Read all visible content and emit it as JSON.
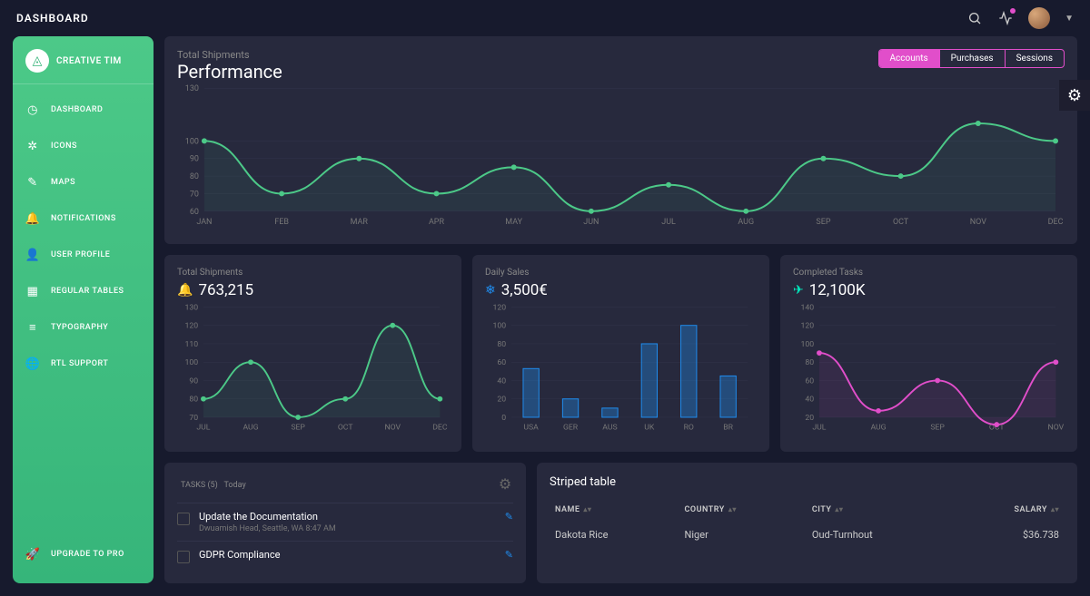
{
  "topbar": {
    "title": "DASHBOARD"
  },
  "sidebar": {
    "brand": "CREATIVE TIM",
    "items": [
      {
        "label": "DASHBOARD",
        "icon": "◷"
      },
      {
        "label": "ICONS",
        "icon": "✲"
      },
      {
        "label": "MAPS",
        "icon": "✎"
      },
      {
        "label": "NOTIFICATIONS",
        "icon": "🔔"
      },
      {
        "label": "USER PROFILE",
        "icon": "👤"
      },
      {
        "label": "REGULAR TABLES",
        "icon": "▦"
      },
      {
        "label": "TYPOGRAPHY",
        "icon": "≡"
      },
      {
        "label": "RTL SUPPORT",
        "icon": "🌐"
      }
    ],
    "upgrade": {
      "label": "UPGRADE TO PRO",
      "icon": "🚀"
    }
  },
  "performance": {
    "subtitle": "Total Shipments",
    "title": "Performance",
    "tabs": [
      "Accounts",
      "Purchases",
      "Sessions"
    ],
    "activeTab": 0
  },
  "cards": {
    "shipments": {
      "subtitle": "Total Shipments",
      "value": "763,215"
    },
    "sales": {
      "subtitle": "Daily Sales",
      "value": "3,500€"
    },
    "completed": {
      "subtitle": "Completed Tasks",
      "value": "12,100K"
    }
  },
  "tasks": {
    "title": "TASKS (5)",
    "sub": "Today",
    "items": [
      {
        "title": "Update the Documentation",
        "subtitle": "Dwuamish Head, Seattle, WA 8:47 AM"
      },
      {
        "title": "GDPR Compliance",
        "subtitle": ""
      }
    ]
  },
  "table": {
    "title": "Striped table",
    "cols": [
      "NAME",
      "COUNTRY",
      "CITY",
      "SALARY"
    ],
    "rows": [
      {
        "name": "Dakota Rice",
        "country": "Niger",
        "city": "Oud-Turnhout",
        "salary": "$36.738"
      }
    ]
  },
  "chart_data": [
    {
      "id": "performance",
      "type": "line",
      "title": "Performance",
      "ylim": [
        60,
        130
      ],
      "yticks": [
        60,
        70,
        80,
        90,
        100,
        130
      ],
      "categories": [
        "JAN",
        "FEB",
        "MAR",
        "APR",
        "MAY",
        "JUN",
        "JUL",
        "AUG",
        "SEP",
        "OCT",
        "NOV",
        "DEC"
      ],
      "values": [
        100,
        70,
        90,
        70,
        85,
        60,
        75,
        60,
        90,
        80,
        110,
        100
      ],
      "color": "#4cc988"
    },
    {
      "id": "shipments",
      "type": "line",
      "title": "Total Shipments",
      "ylim": [
        70,
        130
      ],
      "yticks": [
        70,
        80,
        90,
        100,
        110,
        120,
        130
      ],
      "categories": [
        "JUL",
        "AUG",
        "SEP",
        "OCT",
        "NOV",
        "DEC"
      ],
      "values": [
        80,
        100,
        70,
        80,
        120,
        80
      ],
      "color": "#4cc988"
    },
    {
      "id": "sales",
      "type": "bar",
      "title": "Daily Sales",
      "ylim": [
        0,
        120
      ],
      "yticks": [
        0,
        20,
        40,
        60,
        80,
        100,
        120
      ],
      "categories": [
        "USA",
        "GER",
        "AUS",
        "UK",
        "RO",
        "BR"
      ],
      "values": [
        53,
        20,
        10,
        80,
        100,
        45
      ],
      "color": "#1f8ef1"
    },
    {
      "id": "completed",
      "type": "line",
      "title": "Completed Tasks",
      "ylim": [
        20,
        140
      ],
      "yticks": [
        20,
        40,
        60,
        80,
        100,
        120,
        140
      ],
      "categories": [
        "JUL",
        "AUG",
        "SEP",
        "OCT",
        "NOV"
      ],
      "values": [
        90,
        27,
        60,
        12,
        80
      ],
      "color": "#e14eca"
    }
  ]
}
